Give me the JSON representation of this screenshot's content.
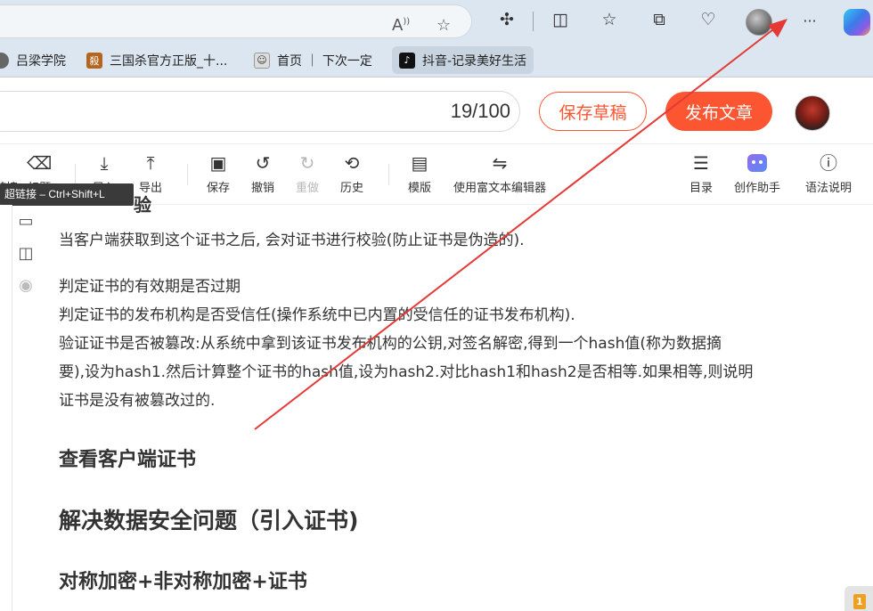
{
  "browser": {
    "read_aloud_icon": "read-aloud-icon",
    "favorite_icon": "star-icon",
    "extensions_icon": "puzzle-icon",
    "split_icon": "split-screen-icon",
    "favorites_icon": "favorites-list-icon",
    "collections_icon": "collections-icon",
    "health_icon": "browser-essentials-icon",
    "more_label": "···"
  },
  "bookmarks": [
    {
      "label": "吕梁学院",
      "fav_color": "#555555"
    },
    {
      "label": "三国杀官方正版_十...",
      "fav_color": "#a0522d",
      "fav_text": "殺"
    },
    {
      "label": "首页 ｜ 下次一定",
      "fav_color": "#888888"
    },
    {
      "label": "抖音-记录美好生活",
      "fav_color": "#111111"
    }
  ],
  "editor": {
    "counter": "19/100",
    "save_draft": "保存草稿",
    "publish": "发布文章"
  },
  "toolbar": {
    "partial_left": [
      "链接",
      "标题",
      "导入"
    ],
    "export": "导出",
    "save": "保存",
    "undo": "撤销",
    "redo": "重做",
    "history": "历史",
    "template": "模版",
    "rich_editor": "使用富文本编辑器",
    "toc": "目录",
    "ai_assistant": "创作助手",
    "grammar": "语法说明"
  },
  "tooltip": "超链接 – Ctrl+Shift+L",
  "content": {
    "partial_heading": "验",
    "line1": "当客户端获取到这个证书之后, 会对证书进行校验(防止证书是伪造的).",
    "line2": "判定证书的有效期是否过期",
    "line3": "判定证书的发布机构是否受信任(操作系统中已内置的受信任的证书发布机构).",
    "line4": "验证证书是否被篡改:从系统中拿到该证书发布机构的公钥,对签名解密,得到一个hash值(称为数据摘",
    "line5": "要),设为hash1.然后计算整个证书的hash值,设为hash2.对比hash1和hash2是否相等.如果相等,则说明",
    "line6": "证书是没有被篡改过的.",
    "heading1": "查看客户端证书",
    "heading2": "解决数据安全问题（引入证书)",
    "heading3": "对称加密+非对称加密+证书"
  },
  "annotation": {
    "color": "#e53935"
  },
  "corner_badge": "1"
}
